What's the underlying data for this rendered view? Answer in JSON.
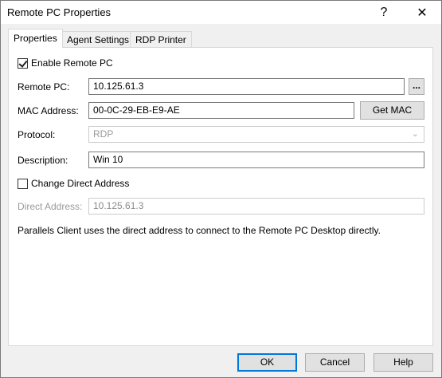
{
  "window": {
    "title": "Remote PC Properties",
    "help_glyph": "?",
    "close_glyph": "✕"
  },
  "tabs": [
    {
      "label": "Properties",
      "active": true
    },
    {
      "label": "Agent Settings",
      "active": false
    },
    {
      "label": "RDP Printer",
      "active": false
    }
  ],
  "form": {
    "enable_remote_pc": {
      "label": "Enable Remote PC",
      "checked": true
    },
    "remote_pc": {
      "label": "Remote PC:",
      "value": "10.125.61.3",
      "browse_label": "..."
    },
    "mac_address": {
      "label": "MAC Address:",
      "value": "00-0C-29-EB-E9-AE",
      "button_label": "Get MAC"
    },
    "protocol": {
      "label": "Protocol:",
      "value": "RDP",
      "disabled": true
    },
    "description": {
      "label": "Description:",
      "value": "Win 10"
    },
    "change_direct_address": {
      "label": "Change Direct Address",
      "checked": false
    },
    "direct_address": {
      "label": "Direct Address:",
      "value": "10.125.61.3",
      "disabled": true
    },
    "info": "Parallels Client uses the direct address to connect to the Remote PC Desktop directly."
  },
  "footer": {
    "ok_label": "OK",
    "cancel_label": "Cancel",
    "help_label": "Help"
  },
  "colors": {
    "window_bg": "#f0f0f0",
    "panel_bg": "#ffffff",
    "default_button_border": "#0078d7",
    "disabled_text": "#9a9a9a"
  }
}
